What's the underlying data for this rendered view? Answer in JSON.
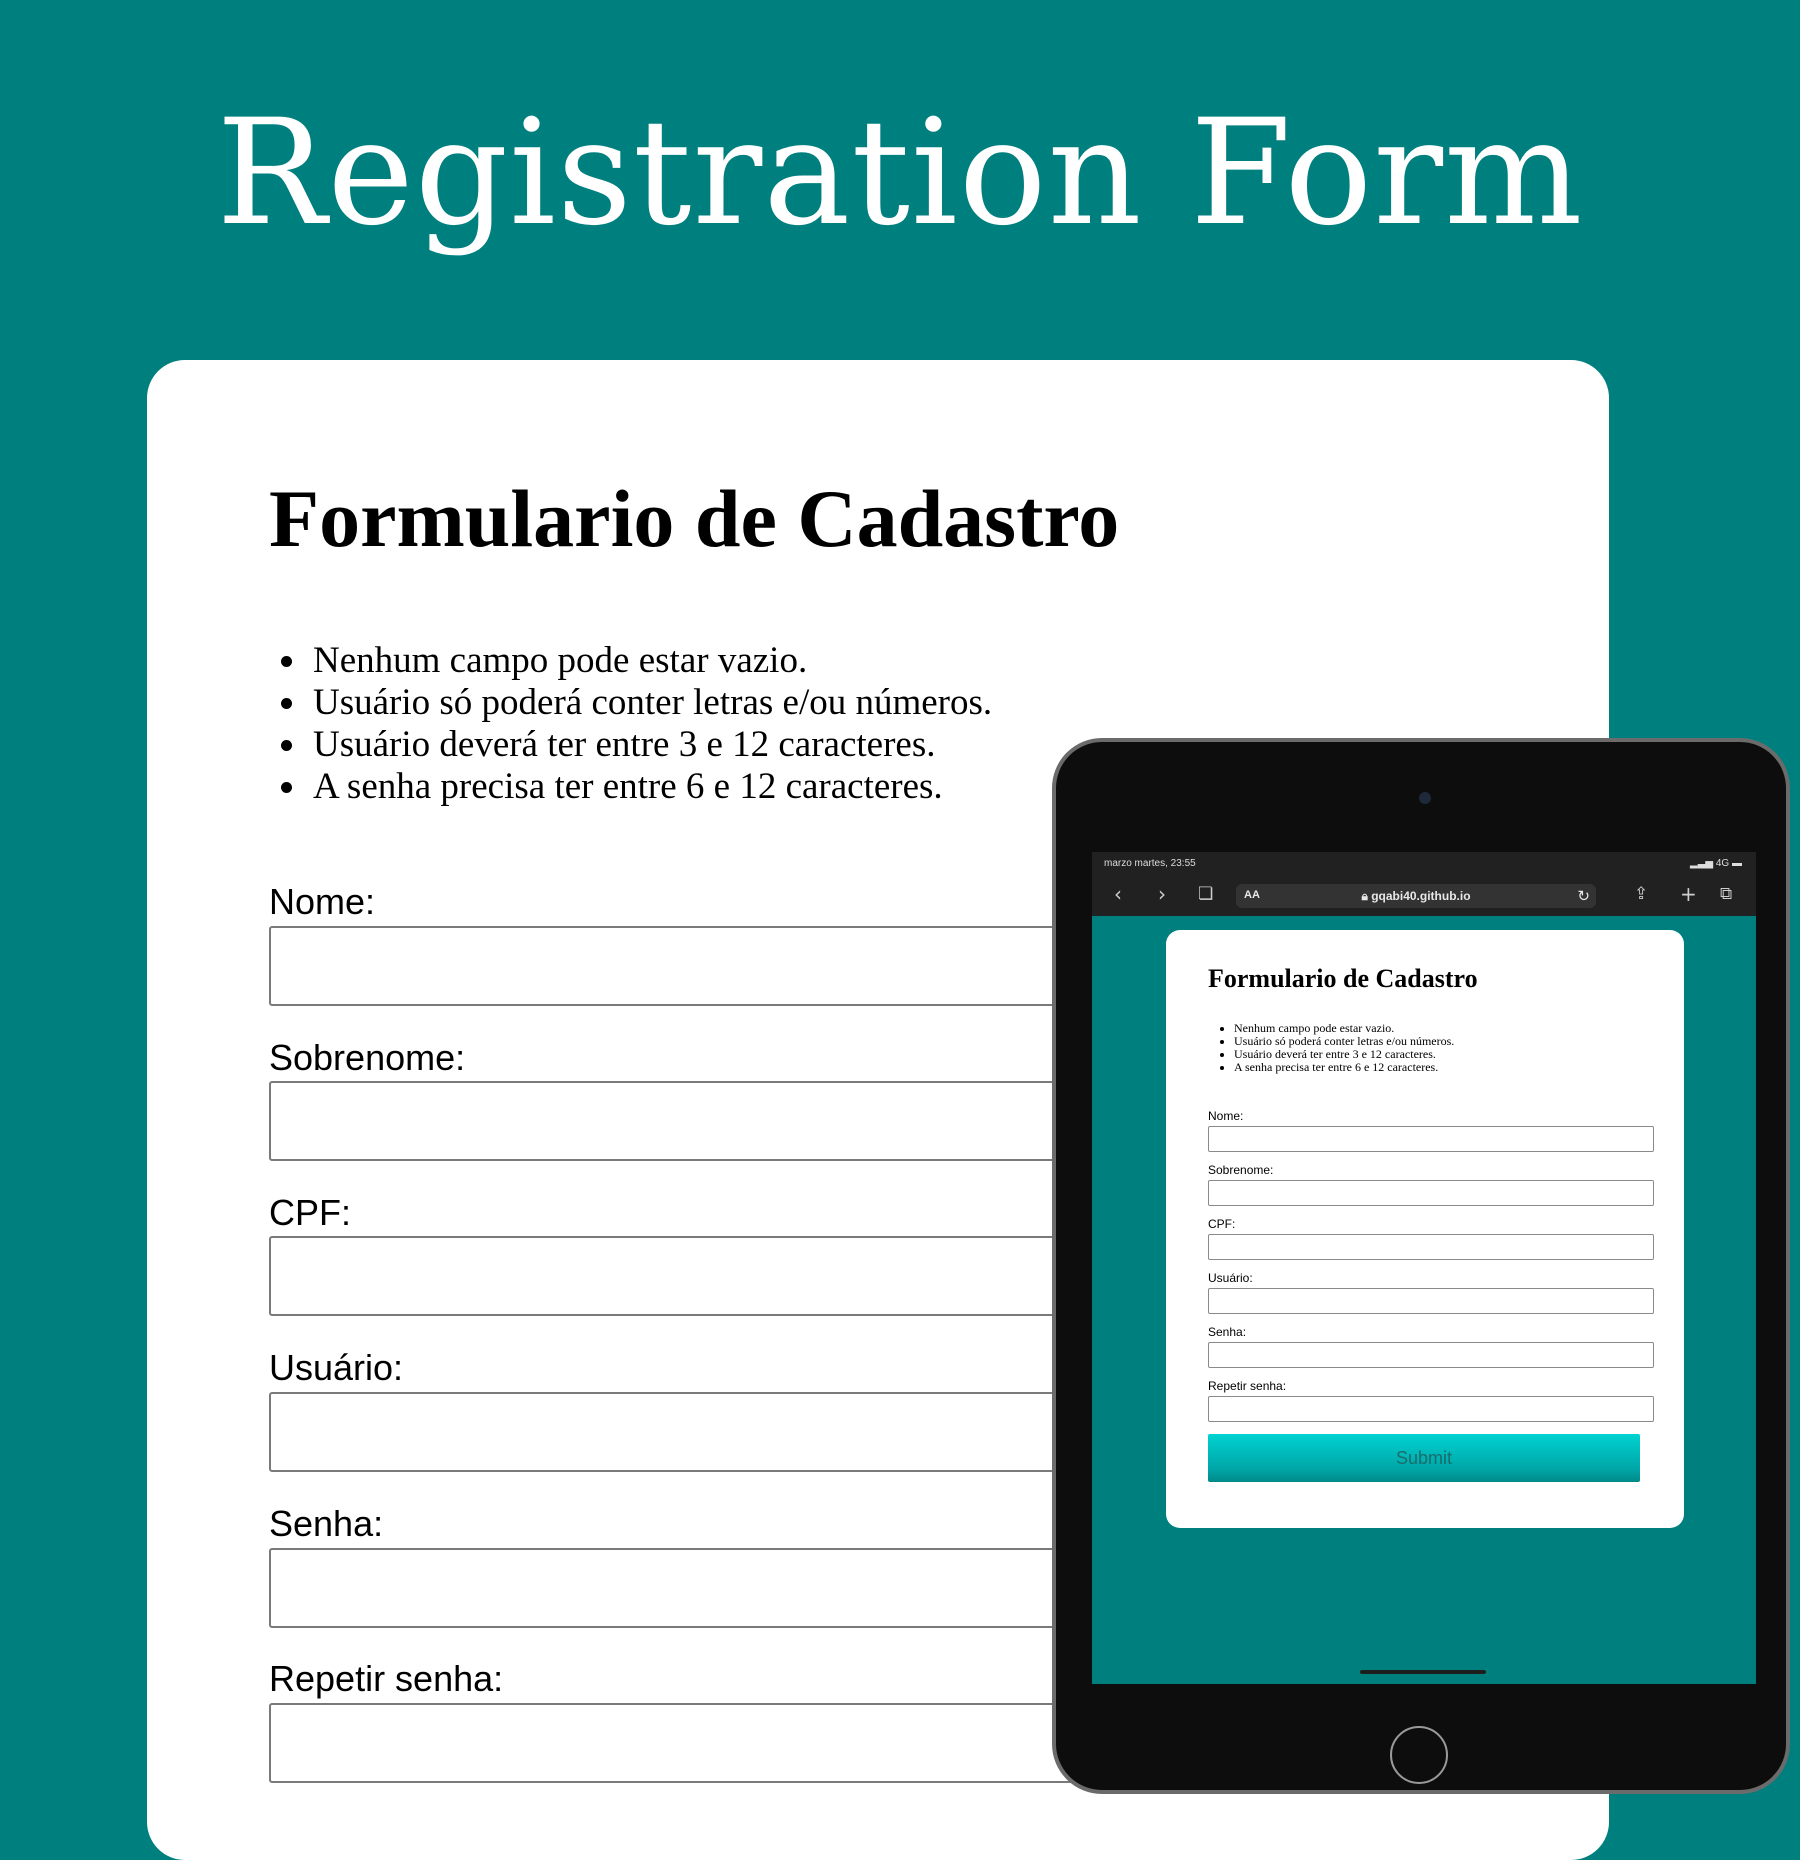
{
  "banner": {
    "title": "Registration Form"
  },
  "form": {
    "title": "Formulario de Cadastro",
    "rules": [
      "Nenhum campo pode estar vazio.",
      "Usuário só poderá conter letras e/ou números.",
      "Usuário deverá ter entre 3 e 12 caracteres.",
      "A senha precisa ter entre 6 e 12 caracteres."
    ],
    "fields": [
      {
        "label": "Nome:",
        "value": ""
      },
      {
        "label": "Sobrenome:",
        "value": ""
      },
      {
        "label": "CPF:",
        "value": ""
      },
      {
        "label": "Usuário:",
        "value": ""
      },
      {
        "label": "Senha:",
        "value": ""
      },
      {
        "label": "Repetir senha:",
        "value": ""
      }
    ],
    "submit_label": "Submit"
  },
  "tablet": {
    "status_time": "marzo martes, 23:55",
    "status_signal": "4G",
    "url_aa": "AA",
    "url": "gqabi40.github.io"
  },
  "colors": {
    "background": "#007f7f",
    "card": "#ffffff",
    "submit": "#00c8c8",
    "tablet_frame": "#0d0d0d"
  },
  "icons": [
    "back-icon",
    "forward-icon",
    "bookmarks-icon",
    "lock-icon",
    "reload-icon",
    "share-icon",
    "new-tab-icon",
    "tabs-icon"
  ]
}
